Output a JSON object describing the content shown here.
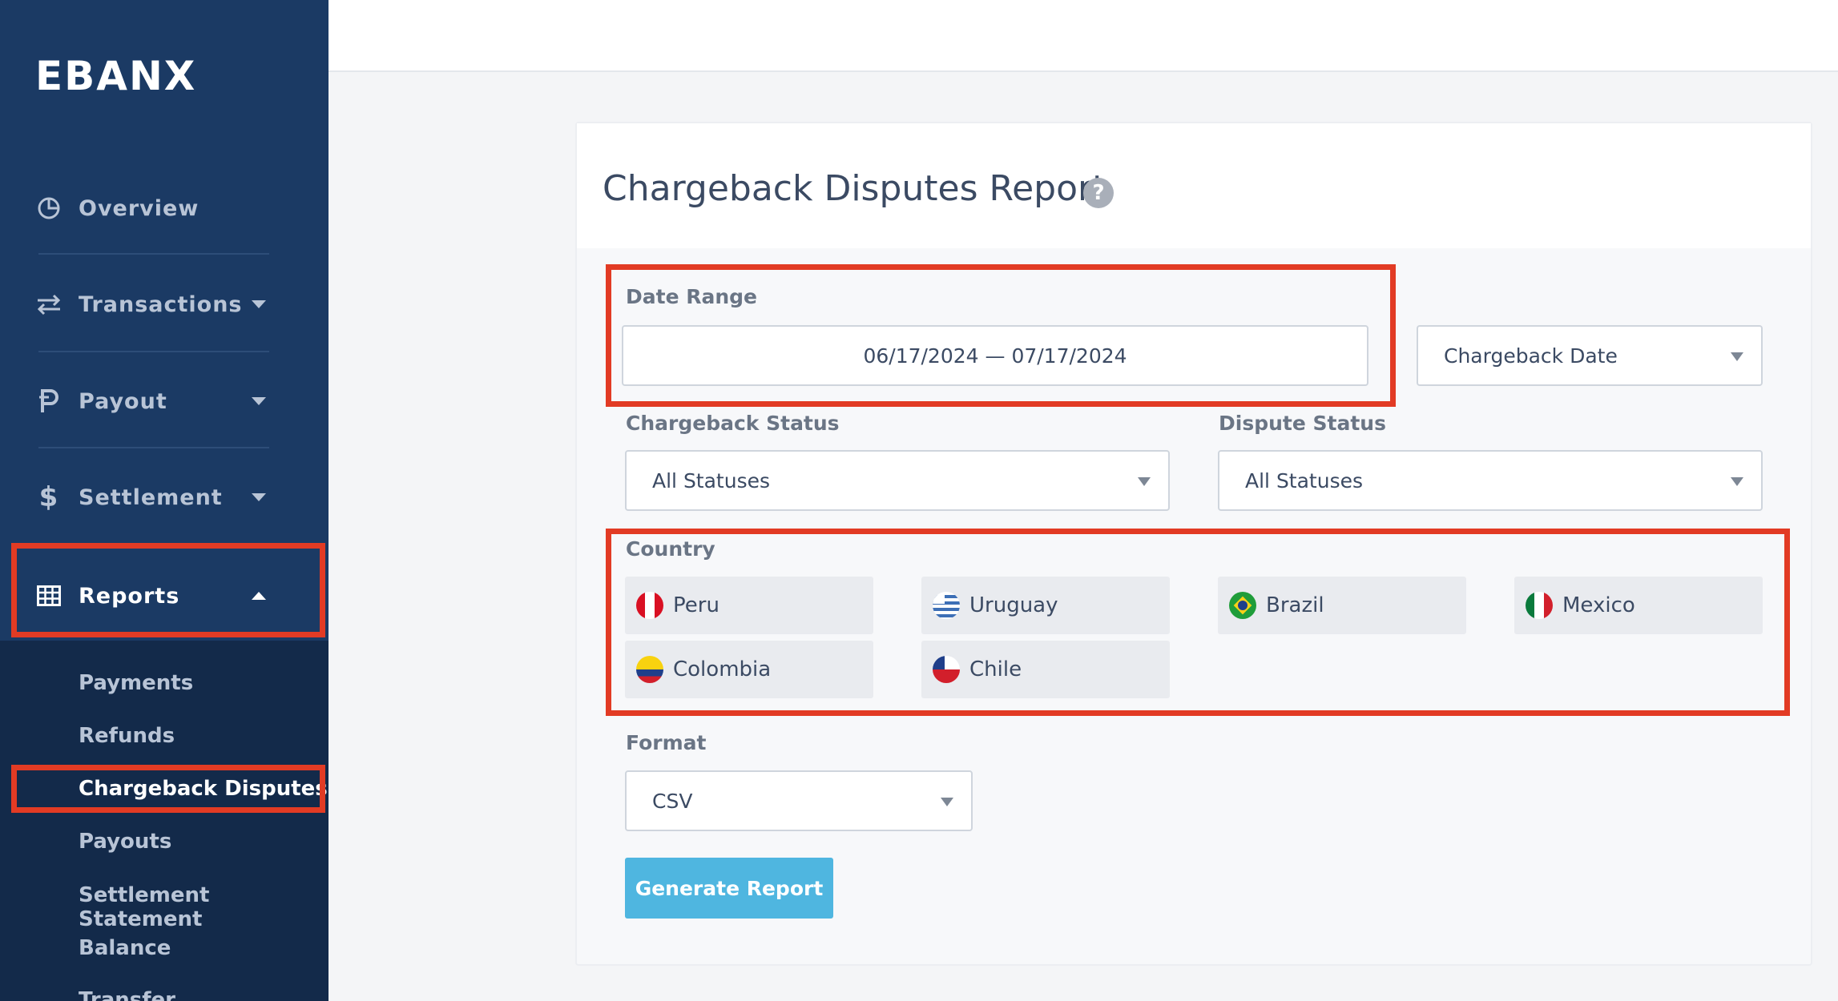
{
  "brand": {
    "logo_text": "EBANX"
  },
  "sidebar": {
    "items": [
      {
        "label": "Overview",
        "icon": "pie-chart-icon"
      },
      {
        "label": "Transactions",
        "icon": "transfer-arrows-icon"
      },
      {
        "label": "Payout",
        "icon": "payout-p-icon"
      },
      {
        "label": "Settlement",
        "icon": "dollar-icon"
      },
      {
        "label": "Reports",
        "icon": "table-grid-icon"
      }
    ],
    "reports_submenu": [
      {
        "label": "Payments"
      },
      {
        "label": "Refunds"
      },
      {
        "label": "Chargeback Disputes"
      },
      {
        "label": "Payouts"
      },
      {
        "label": "Settlement Statement"
      },
      {
        "label": "Balance"
      },
      {
        "label": "Transfer"
      }
    ]
  },
  "report": {
    "title": "Chargeback Disputes Report",
    "help_glyph": "?",
    "date_range": {
      "label": "Date Range",
      "value": "06/17/2024 — 07/17/2024"
    },
    "date_type": {
      "value": "Chargeback Date"
    },
    "chargeback_status": {
      "label": "Chargeback Status",
      "value": "All Statuses"
    },
    "dispute_status": {
      "label": "Dispute Status",
      "value": "All Statuses"
    },
    "country": {
      "label": "Country",
      "options": [
        "Peru",
        "Uruguay",
        "Brazil",
        "Mexico",
        "Colombia",
        "Chile"
      ]
    },
    "format": {
      "label": "Format",
      "value": "CSV"
    },
    "generate_label": "Generate Report"
  },
  "colors": {
    "sidebar_bg": "#1b3a64",
    "submenu_bg": "#132a4a",
    "highlight": "#e23b24",
    "button_bg": "#4fb6e0"
  }
}
